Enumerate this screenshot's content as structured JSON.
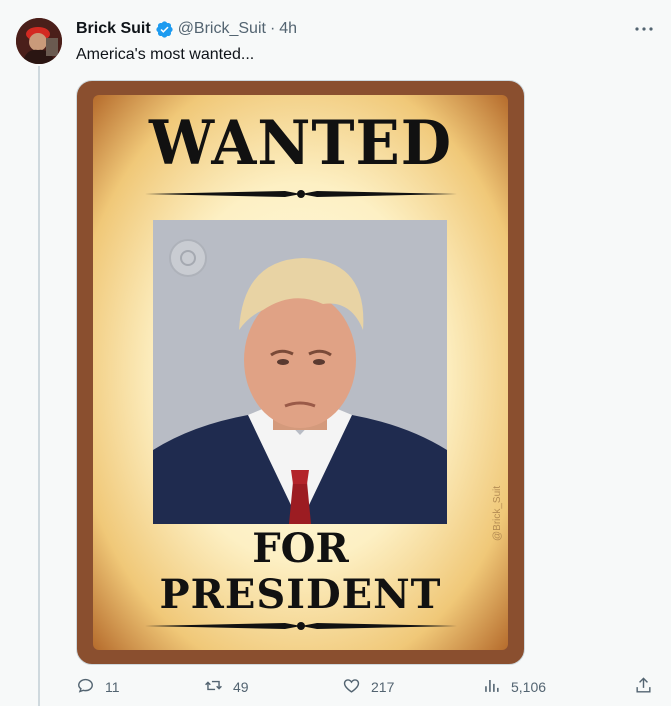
{
  "tweet": {
    "author_name": "Brick Suit",
    "handle": "@Brick_Suit",
    "separator": "·",
    "time": "4h",
    "text": "America's most wanted...",
    "verified_color": "#1d9bf0"
  },
  "poster": {
    "headline": "WANTED",
    "line1": "FOR",
    "line2": "PRESIDENT",
    "watermark": "@Brick_Suit"
  },
  "actions": {
    "replies": "11",
    "reposts": "49",
    "likes": "217",
    "views": "5,106"
  },
  "icons": [
    "more-icon",
    "reply-icon",
    "repost-icon",
    "like-icon",
    "views-icon",
    "share-icon"
  ]
}
